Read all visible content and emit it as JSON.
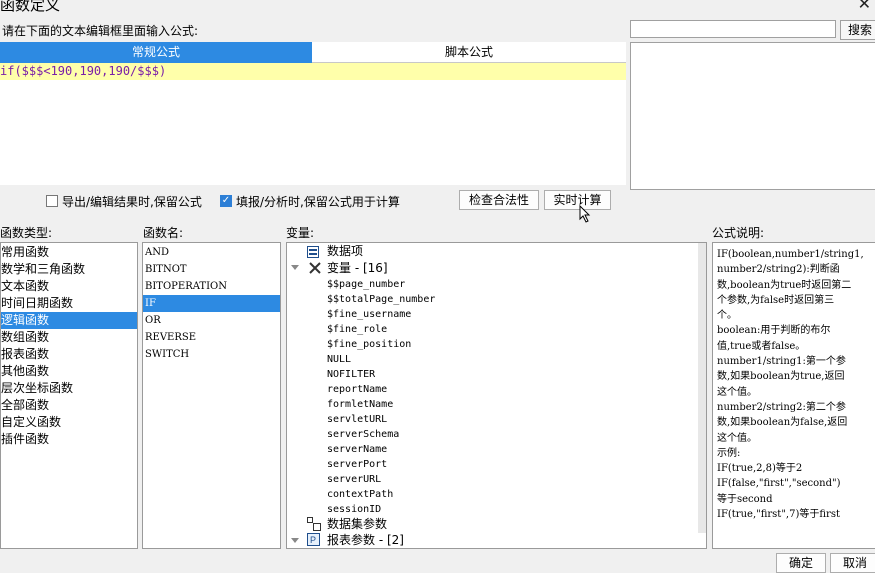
{
  "window": {
    "title": "函数定义",
    "close_glyph": "✕"
  },
  "editor": {
    "instruction": "请在下面的文本编辑框里面输入公式:",
    "tabs": [
      "常规公式",
      "脚本公式"
    ],
    "formula": "if($$$<190,190,190/$$$)"
  },
  "search": {
    "value": "",
    "button": "搜索"
  },
  "options": {
    "keep_formula_export": {
      "label": "导出/编辑结果时,保留公式",
      "checked": false
    },
    "keep_formula_fill": {
      "label": "填报/分析时,保留公式用于计算",
      "checked": true
    },
    "check_glyph": "✓"
  },
  "buttons": {
    "check": "检查合法性",
    "calc": "实时计算",
    "ok": "确定",
    "cancel": "取消"
  },
  "sections": {
    "type": "函数类型:",
    "name": "函数名:",
    "var": "变量:",
    "desc": "公式说明:"
  },
  "function_types": [
    "常用函数",
    "数学和三角函数",
    "文本函数",
    "时间日期函数",
    "逻辑函数",
    "数组函数",
    "报表函数",
    "其他函数",
    "层次坐标函数",
    "全部函数",
    "自定义函数",
    "插件函数"
  ],
  "function_types_selected": 4,
  "function_names": [
    "AND",
    "BITNOT",
    "BITOPERATION",
    "IF",
    "OR",
    "REVERSE",
    "SWITCH"
  ],
  "function_names_selected": 3,
  "variables": {
    "root_data": "数据项",
    "var_group": "变量 - [16]",
    "items": [
      "$$page_number",
      "$$totalPage_number",
      "$fine_username",
      "$fine_role",
      "$fine_position",
      "NULL",
      "NOFILTER",
      "reportName",
      "formletName",
      "servletURL",
      "serverSchema",
      "serverName",
      "serverPort",
      "serverURL",
      "contextPath",
      "sessionID"
    ],
    "dataset_params": "数据集参数",
    "report_params": "报表参数 - [2]"
  },
  "description": "IF(boolean,number1/string1,\nnumber2/string2):判断函\n数,boolean为true时返回第二\n个参数,为false时返回第三\n个。\nboolean:用于判断的布尔\n值,true或者false。\nnumber1/string1:第一个参\n数,如果boolean为true,返回\n这个值。\nnumber2/string2:第二个参\n数,如果boolean为false,返回\n这个值。\n示例:\nIF(true,2,8)等于2\nIF(false,\"first\",\"second\")\n等于second\nIF(true,\"first\",7)等于first"
}
